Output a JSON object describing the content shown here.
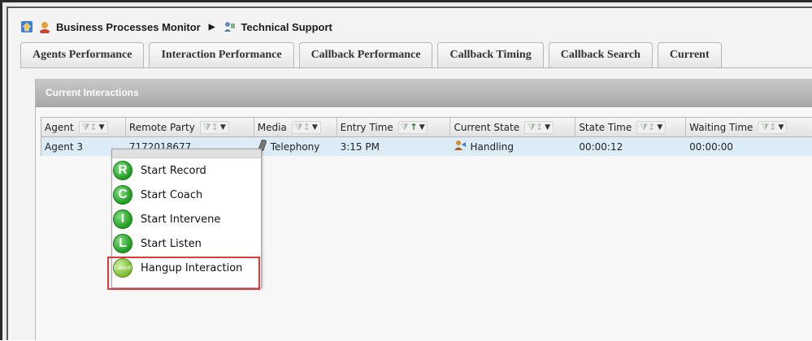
{
  "breadcrumb": {
    "items": [
      "Business Processes Monitor",
      "Technical Support"
    ],
    "separator": "▶"
  },
  "tabs": [
    "Agents Performance",
    "Interaction Performance",
    "Callback Performance",
    "Callback Timing",
    "Callback Search",
    "Current"
  ],
  "panel": {
    "title": "Current Interactions"
  },
  "grid": {
    "columns": [
      "Agent",
      "Remote Party",
      "Media",
      "Entry Time",
      "Current State",
      "State Time",
      "Waiting Time"
    ],
    "rows": [
      {
        "agent": "Agent 3",
        "remote_party": "7172018677",
        "media": "Telephony",
        "entry_time": "3:15 PM",
        "current_state": "Handling",
        "state_time": "00:00:12",
        "waiting_time": "00:00:00"
      }
    ]
  },
  "context_menu": {
    "items": [
      {
        "label": "Start Record",
        "icon_letter": "R"
      },
      {
        "label": "Start Coach",
        "icon_letter": "C"
      },
      {
        "label": "Start Intervene",
        "icon_letter": "I"
      },
      {
        "label": "Start Listen",
        "icon_letter": "L"
      },
      {
        "label": "Hangup Interaction",
        "icon_letter": "Cancel"
      }
    ]
  },
  "colors": {
    "highlight": "#dc3b3b",
    "selected_row": "#dcecf7",
    "menu_icon_green": "#1f9a1f"
  }
}
